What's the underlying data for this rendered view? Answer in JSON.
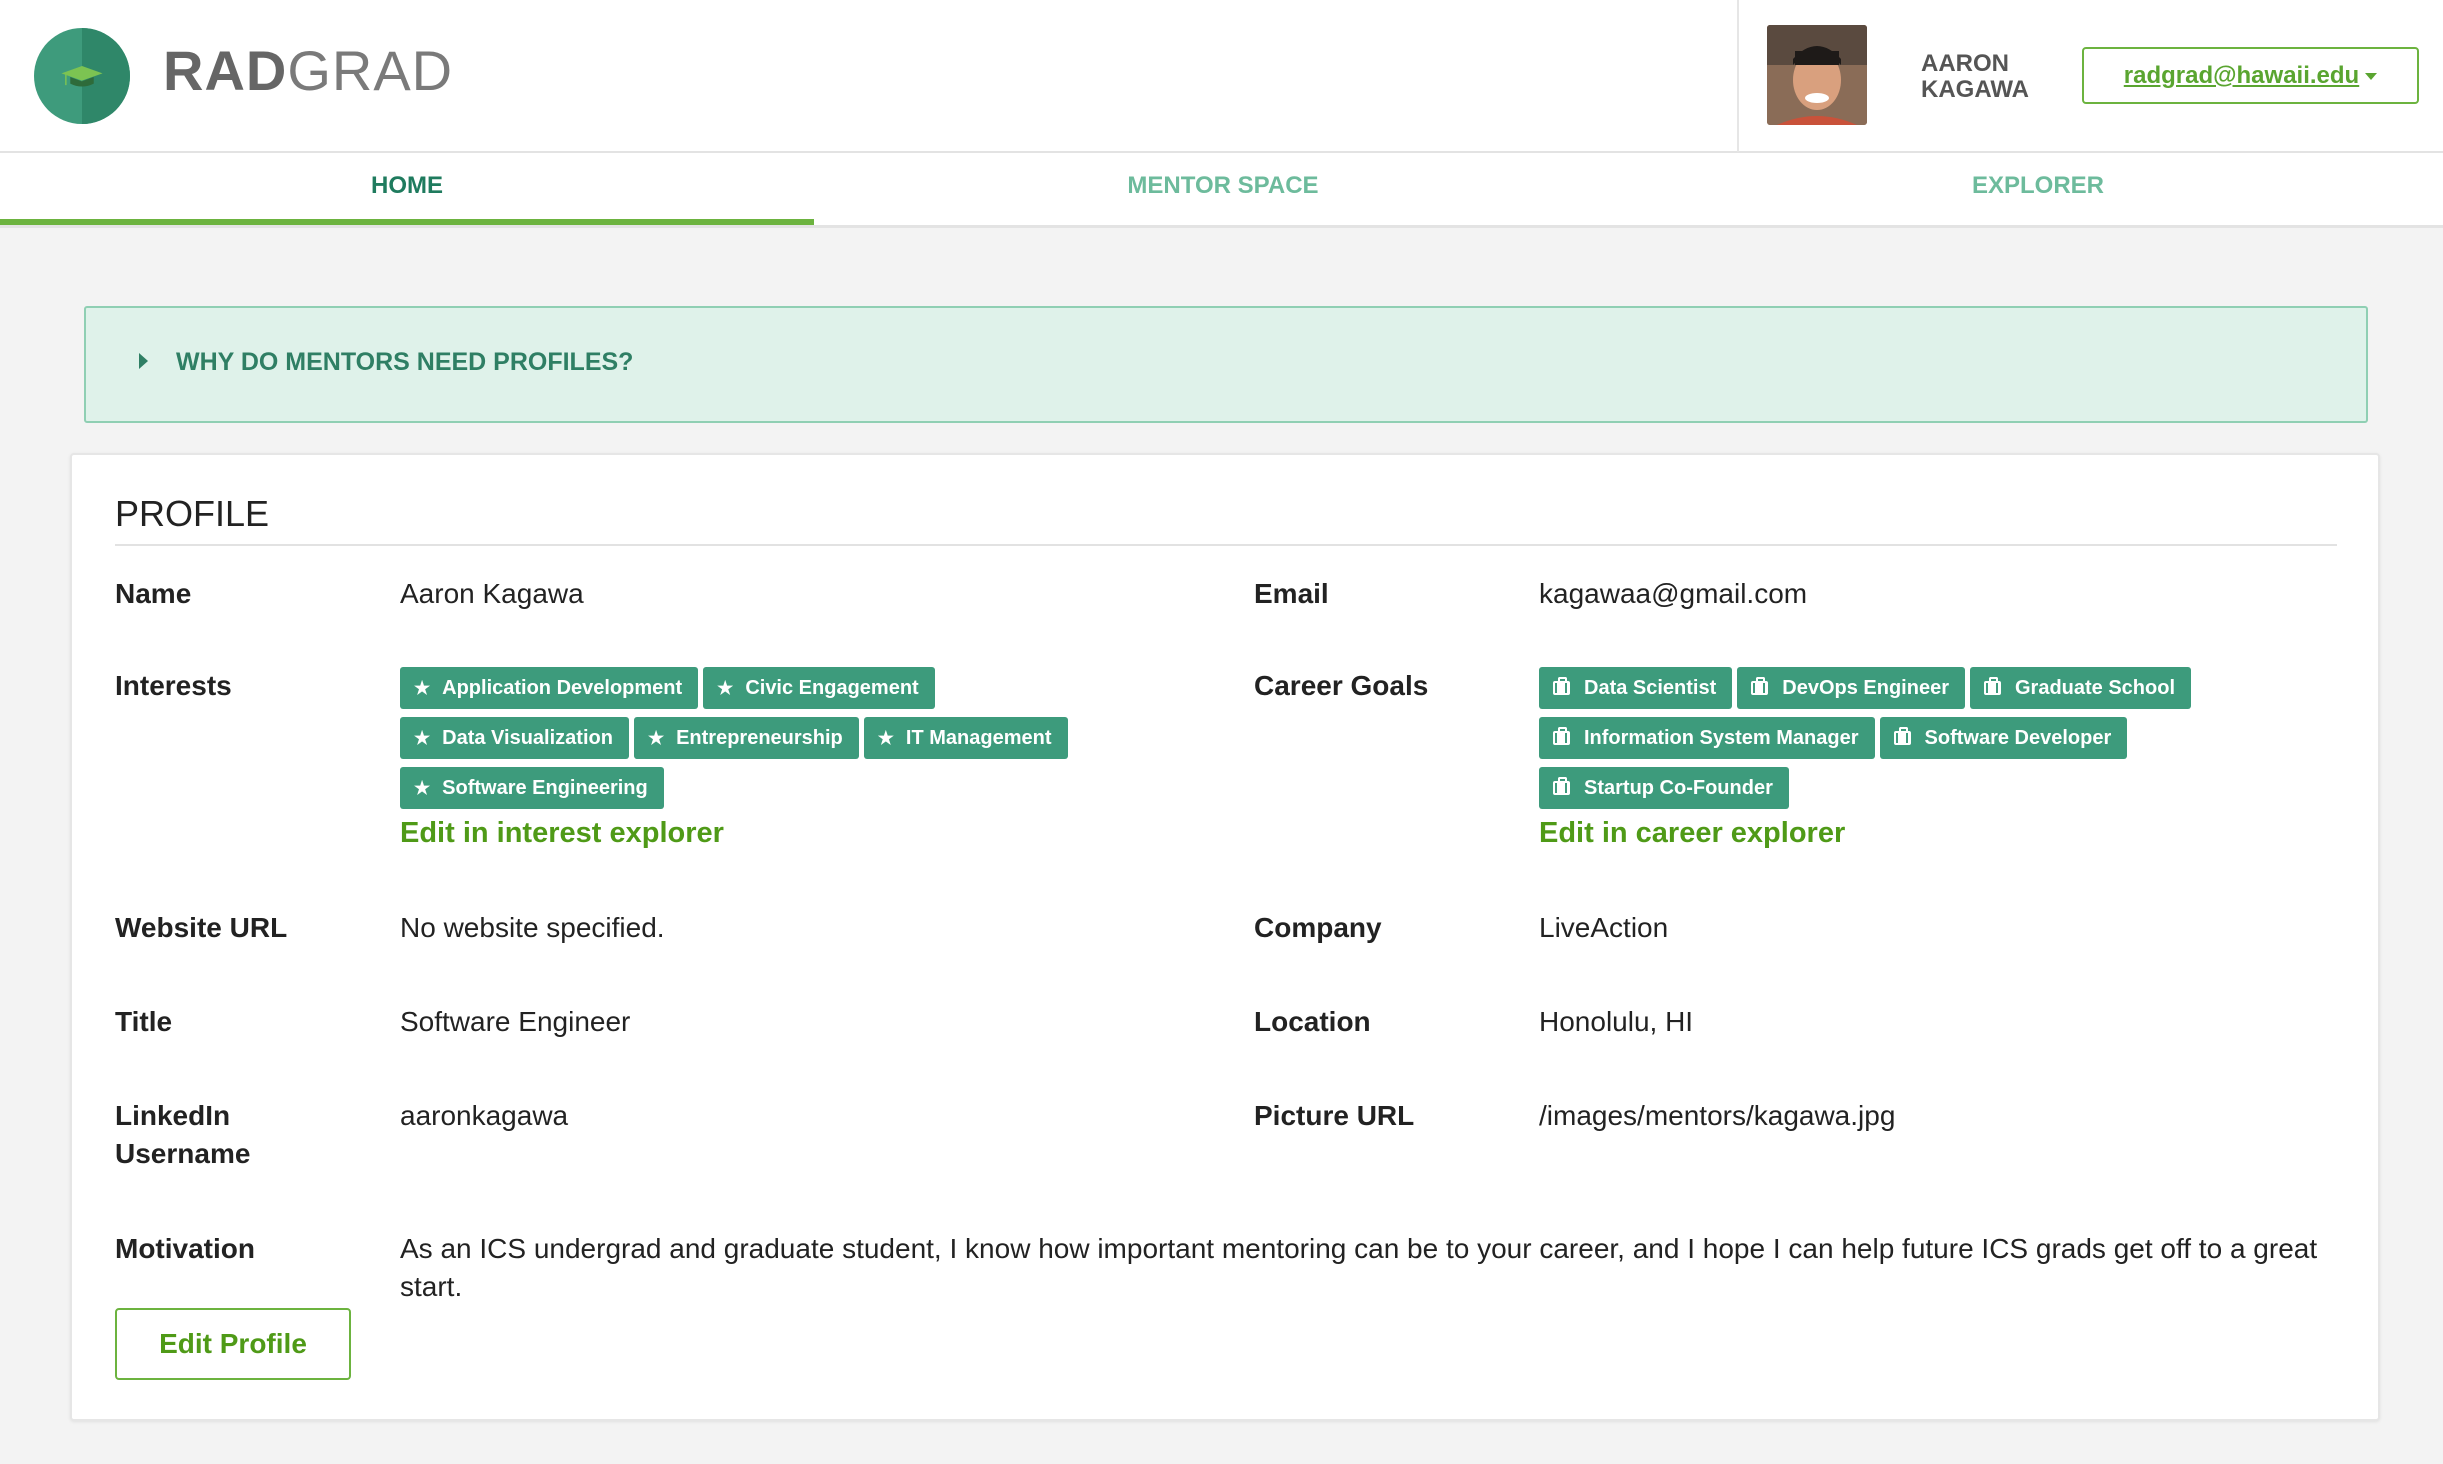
{
  "brand": {
    "name_bold": "RAD",
    "name_light": "GRAD",
    "colors": {
      "primary": "#3d9b7c",
      "accent": "#6cb33f",
      "link": "#4f9a17",
      "accordion_bg": "#dff2ea"
    }
  },
  "header": {
    "user_first": "AARON",
    "user_last": "KAGAWA",
    "user_menu_label": "radgrad@hawaii.edu"
  },
  "nav": {
    "tabs": [
      {
        "label": "HOME",
        "active": true
      },
      {
        "label": "MENTOR SPACE",
        "active": false
      },
      {
        "label": "EXPLORER",
        "active": false
      }
    ]
  },
  "accordion": {
    "title": "WHY DO MENTORS NEED PROFILES?"
  },
  "profile": {
    "heading": "PROFILE",
    "labels": {
      "name": "Name",
      "email": "Email",
      "interests": "Interests",
      "career_goals": "Career Goals",
      "website": "Website URL",
      "company": "Company",
      "title": "Title",
      "location": "Location",
      "linkedin_1": "LinkedIn",
      "linkedin_2": "Username",
      "picture": "Picture URL",
      "motivation": "Motivation"
    },
    "values": {
      "name": "Aaron Kagawa",
      "email": "kagawaa@gmail.com",
      "website": "No website specified.",
      "company": "LiveAction",
      "title": "Software Engineer",
      "location": "Honolulu, HI",
      "linkedin": "aaronkagawa",
      "picture": "/images/mentors/kagawa.jpg",
      "motivation": "As an ICS undergrad and graduate student, I know how important mentoring can be to your career, and I hope I can help future ICS grads get off to a great start."
    },
    "interests": [
      "Application Development",
      "Civic Engagement",
      "Data Visualization",
      "Entrepreneurship",
      "IT Management",
      "Software Engineering"
    ],
    "career_goals": [
      "Data Scientist",
      "DevOps Engineer",
      "Graduate School",
      "Information System Manager",
      "Software Developer",
      "Startup Co-Founder"
    ],
    "interest_link": "Edit in interest explorer",
    "career_link": "Edit in career explorer",
    "edit_button": "Edit Profile"
  }
}
